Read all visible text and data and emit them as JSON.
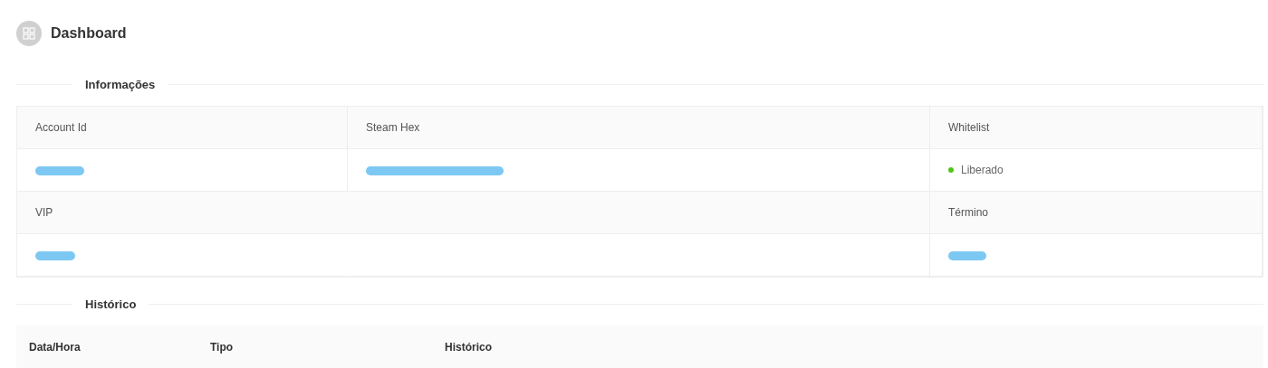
{
  "page": {
    "title": "Dashboard"
  },
  "info": {
    "title": "Informações",
    "rows": [
      [
        {
          "label": "Account Id",
          "kind": "redacted"
        },
        {
          "label": "Steam Hex",
          "kind": "redacted"
        },
        {
          "label": "Whitelist",
          "kind": "status",
          "value": "Liberado",
          "color": "#52c41a"
        }
      ],
      [
        {
          "label": "VIP",
          "kind": "redacted"
        },
        "",
        {
          "label": "Término",
          "kind": "redacted"
        }
      ]
    ]
  },
  "history": {
    "title": "Histórico",
    "columns": [
      "Data/Hora",
      "Tipo",
      "Histórico"
    ]
  }
}
